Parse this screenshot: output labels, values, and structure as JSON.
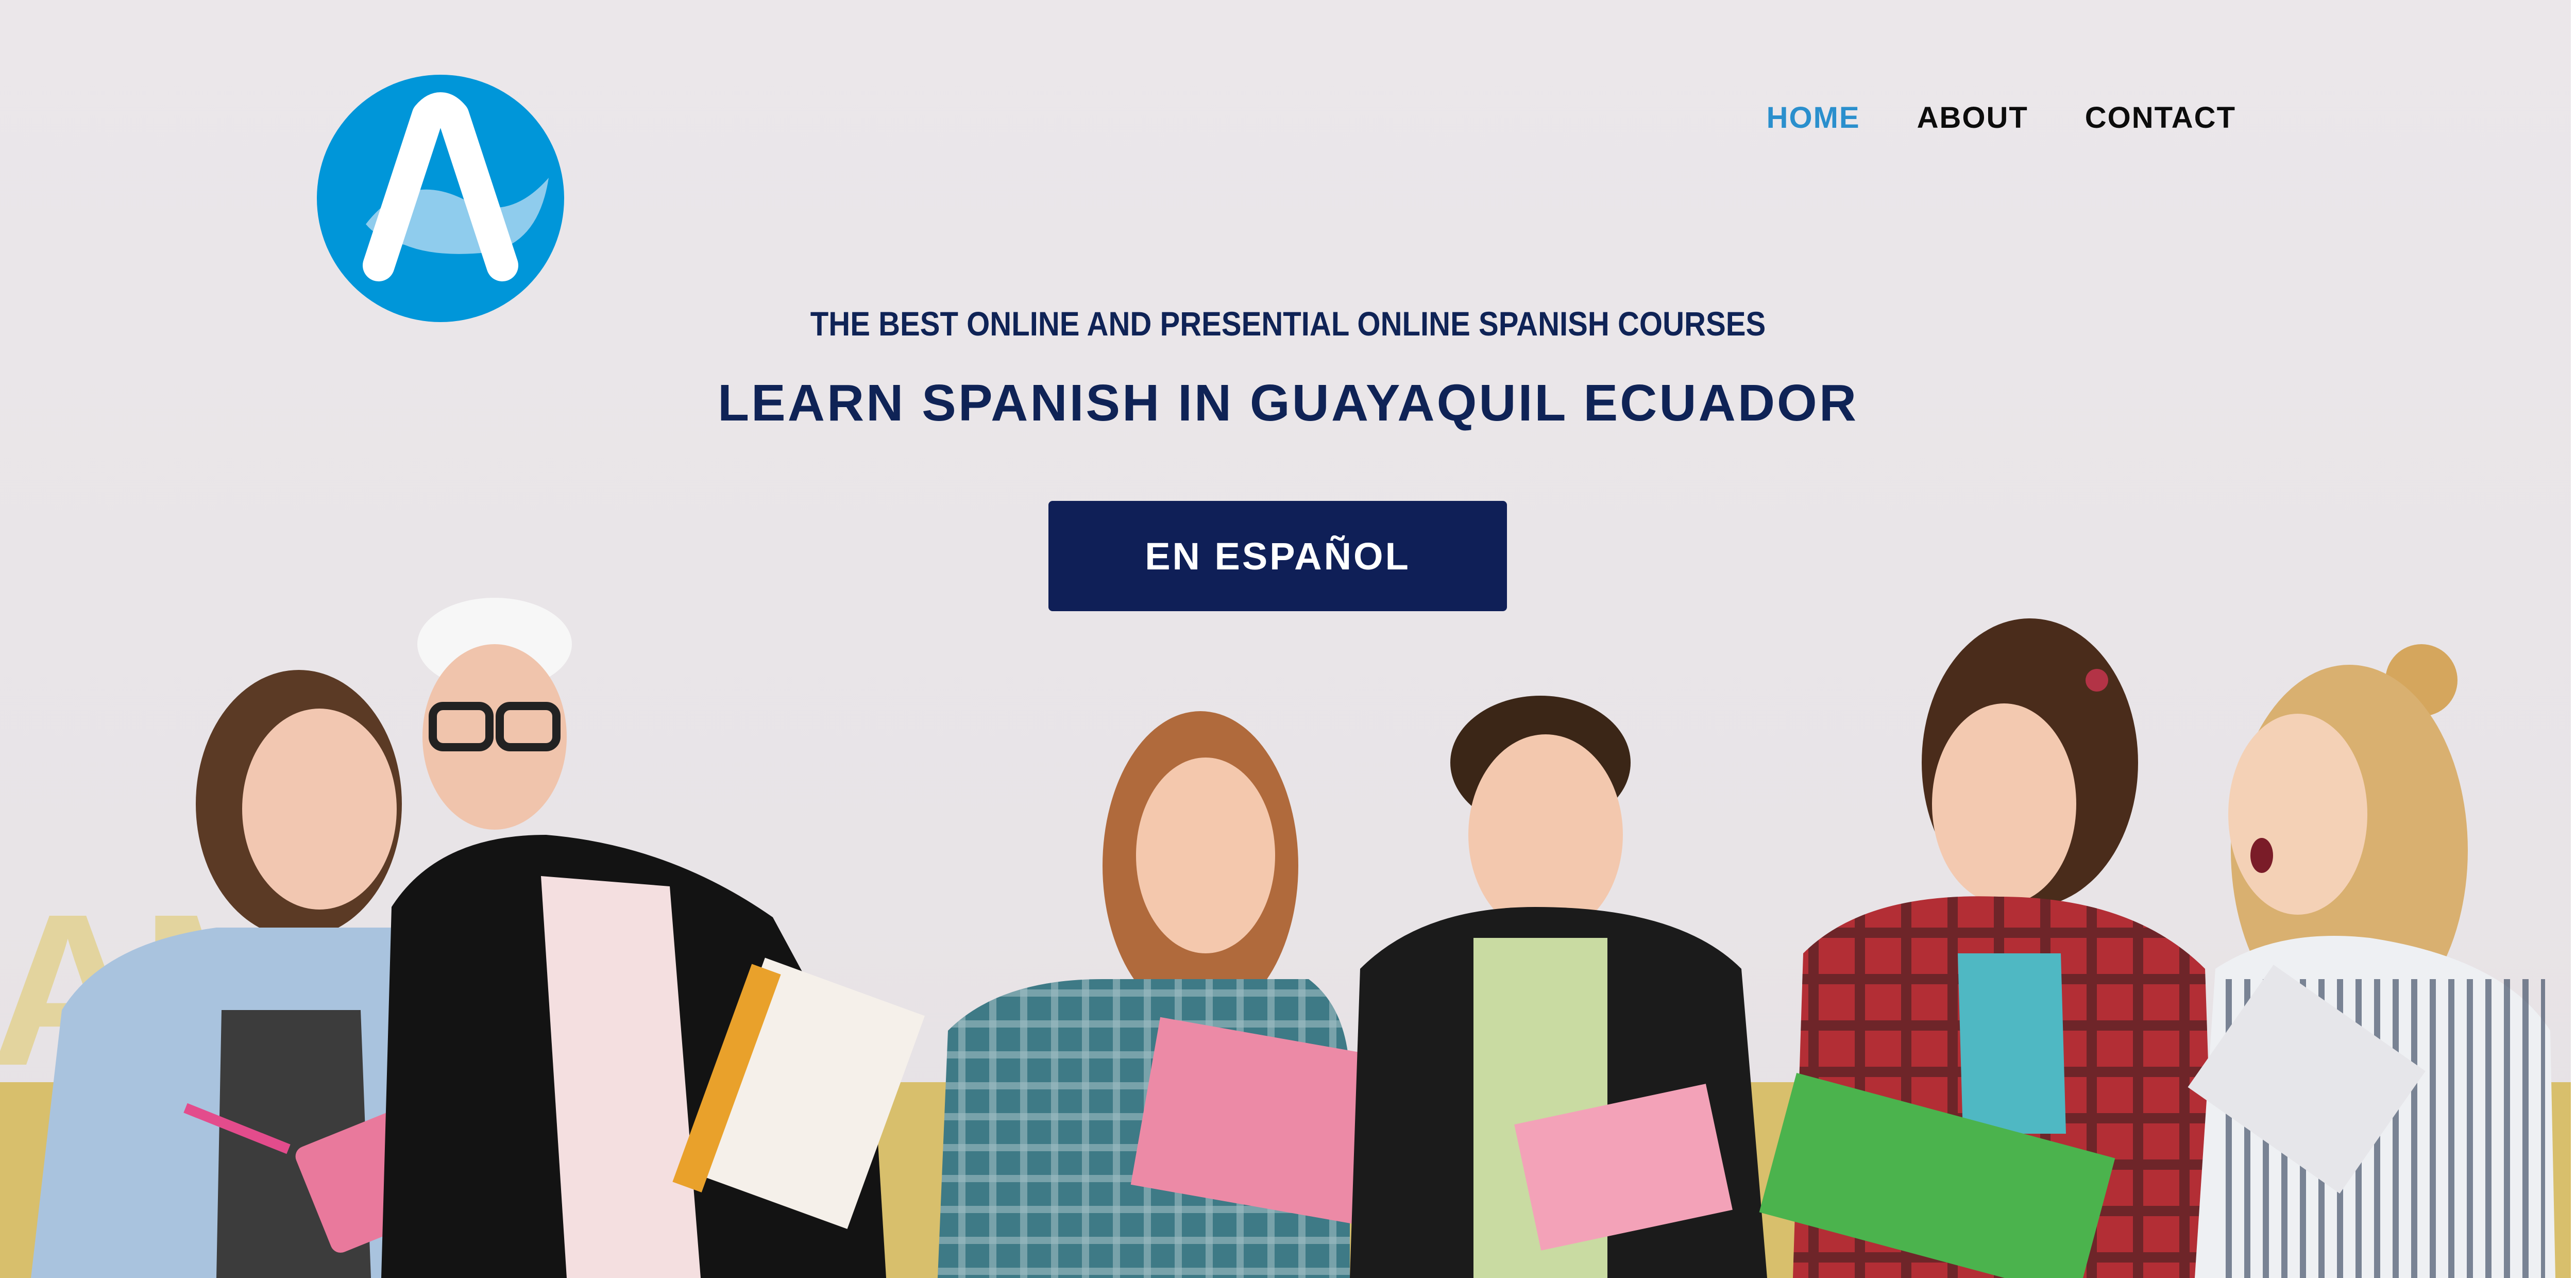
{
  "nav": {
    "items": [
      {
        "label": "HOME",
        "active": true
      },
      {
        "label": "ABOUT",
        "active": false
      },
      {
        "label": "CONTACT",
        "active": false
      }
    ]
  },
  "hero": {
    "subtitle": "THE BEST ONLINE AND PRESENTIAL ONLINE SPANISH COURSES",
    "title": "LEARN SPANISH IN GUAYAQUIL ECUADOR",
    "cta_label": "EN ESPAÑOL"
  },
  "background": {
    "wall_letters": "AM"
  },
  "colors": {
    "accent": "#2a8fcd",
    "navy": "#0f2356",
    "button": "#0f1f57",
    "logo_blue": "#0096d9"
  },
  "icons": {
    "logo": "letter-a-logo"
  }
}
